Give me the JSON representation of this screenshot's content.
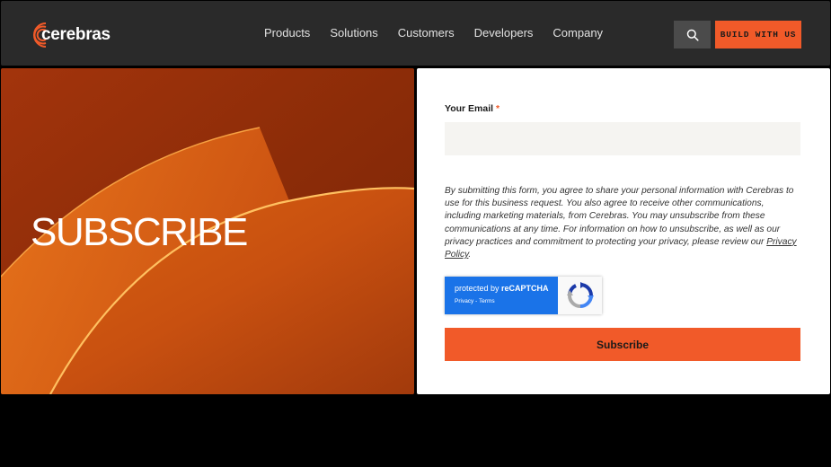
{
  "header": {
    "logo_text": "cerebras",
    "nav": [
      "Products",
      "Solutions",
      "Customers",
      "Developers",
      "Company"
    ],
    "search_icon": "search-icon",
    "build_label": "BUILD WITH US"
  },
  "hero": {
    "title": "SUBSCRIBE"
  },
  "form": {
    "email_label": "Your Email",
    "required_mark": "*",
    "email_value": "",
    "consent_text": "By submitting this form, you agree to share your personal information with Cerebras to use for this business request. You also agree to receive other communications, including marketing materials, from Cerebras. You may unsubscribe from these communications at any time. For information on how to unsubscribe, as well as our privacy practices and commitment to protecting your privacy, please review our",
    "privacy_link": "Privacy Policy",
    "consent_end": ".",
    "recaptcha_prefix": "protected by",
    "recaptcha_brand": "reCAPTCHA",
    "recaptcha_privacy": "Privacy",
    "recaptcha_sep": " - ",
    "recaptcha_terms": "Terms",
    "submit_label": "Subscribe"
  },
  "colors": {
    "accent": "#f15a29",
    "header_bg": "#2a2a2a",
    "recaptcha_blue": "#1a73e8"
  }
}
